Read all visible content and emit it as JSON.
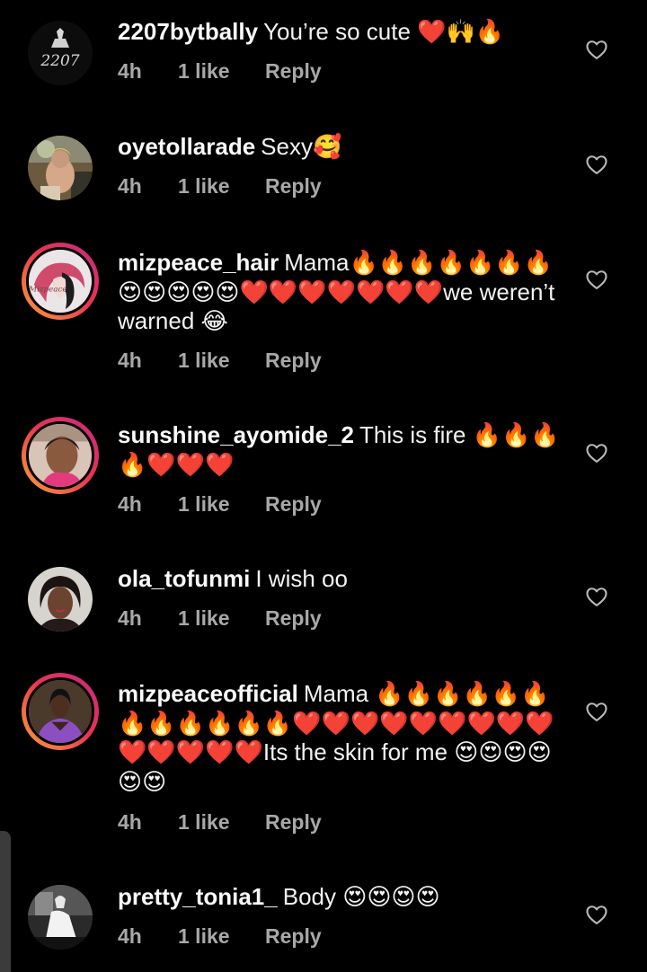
{
  "comments": [
    {
      "username": "2207bytbally",
      "text": "You’re so cute ❤️🙌🔥",
      "time": "4h",
      "likes": "1 like",
      "reply": "Reply",
      "avatar_logo": "2207"
    },
    {
      "username": "oyetollarade",
      "text": "Sexy🥰",
      "time": "4h",
      "likes": "1 like",
      "reply": "Reply"
    },
    {
      "username": "mizpeace_hair",
      "text": "Mama🔥🔥🔥🔥🔥🔥🔥😍😍😍😍😍❤️❤️❤️❤️❤️❤️❤️we weren’t warned 😂",
      "time": "4h",
      "likes": "1 like",
      "reply": "Reply",
      "avatar_logo": "Mizpeace"
    },
    {
      "username": "sunshine_ayomide_2",
      "text": "This is fire 🔥🔥🔥🔥❤️❤️❤️",
      "time": "4h",
      "likes": "1 like",
      "reply": "Reply"
    },
    {
      "username": "ola_tofunmi",
      "text": "I wish oo",
      "time": "4h",
      "likes": "1 like",
      "reply": "Reply"
    },
    {
      "username": "mizpeaceofficial",
      "text": "Mama 🔥🔥🔥🔥🔥🔥🔥🔥🔥🔥🔥🔥❤️❤️❤️❤️❤️❤️❤️❤️❤️❤️❤️❤️❤️❤️Its the skin for me 😍😍😍😍😍😍",
      "time": "4h",
      "likes": "1 like",
      "reply": "Reply"
    },
    {
      "username": "pretty_tonia1_",
      "text": "Body 😍😍😍😍",
      "time": "4h",
      "likes": "1 like",
      "reply": "Reply"
    }
  ],
  "icons": {
    "like": "heart-outline-icon"
  },
  "colors": {
    "background": "#000000",
    "text": "#f2f2f2",
    "meta": "#a8a8a8",
    "story_ring_start": "#f9a23a",
    "story_ring_end": "#c22a86"
  }
}
